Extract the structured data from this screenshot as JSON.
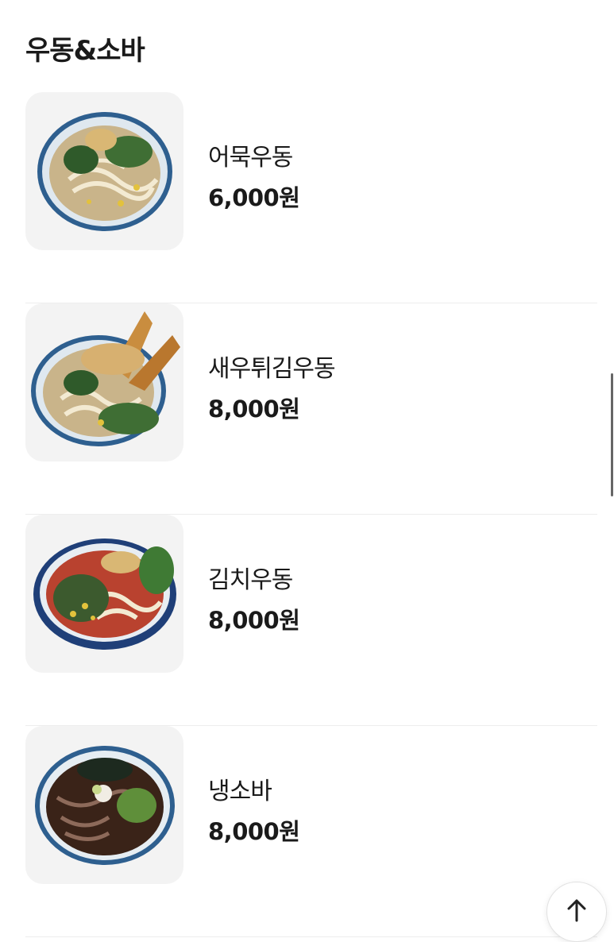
{
  "section": {
    "title": "우동&소바"
  },
  "items": [
    {
      "name": "어묵우동",
      "price": "6,000원",
      "image": "udon-bowl-fishcake"
    },
    {
      "name": "새우튀김우동",
      "price": "8,000원",
      "image": "udon-bowl-shrimp-tempura"
    },
    {
      "name": "김치우동",
      "price": "8,000원",
      "image": "udon-bowl-kimchi"
    },
    {
      "name": "냉소바",
      "price": "8,000원",
      "image": "soba-bowl-cold"
    }
  ],
  "scroll_top": {
    "icon": "arrow-up-icon"
  }
}
